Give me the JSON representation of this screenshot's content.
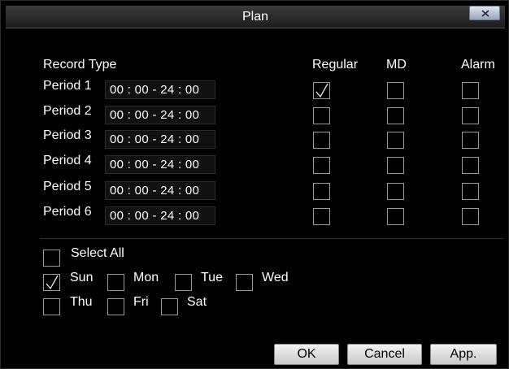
{
  "window": {
    "title": "Plan"
  },
  "header": {
    "record_type_label": "Record Type",
    "columns": [
      "Regular",
      "MD",
      "Alarm"
    ]
  },
  "periods": [
    {
      "label": "Period 1",
      "time": "00 : 00 - 24 : 00",
      "regular": true,
      "md": false,
      "alarm": false
    },
    {
      "label": "Period 2",
      "time": "00 : 00 - 24 : 00",
      "regular": false,
      "md": false,
      "alarm": false
    },
    {
      "label": "Period 3",
      "time": "00 : 00 - 24 : 00",
      "regular": false,
      "md": false,
      "alarm": false
    },
    {
      "label": "Period 4",
      "time": "00 : 00 - 24 : 00",
      "regular": false,
      "md": false,
      "alarm": false
    },
    {
      "label": "Period 5",
      "time": "00 : 00 - 24 : 00",
      "regular": false,
      "md": false,
      "alarm": false
    },
    {
      "label": "Period 6",
      "time": "00 : 00 - 24 : 00",
      "regular": false,
      "md": false,
      "alarm": false
    }
  ],
  "days": {
    "select_all": {
      "label": "Select All",
      "checked": false
    },
    "items": [
      {
        "label": "Sun",
        "checked": true
      },
      {
        "label": "Mon",
        "checked": false
      },
      {
        "label": "Tue",
        "checked": false
      },
      {
        "label": "Wed",
        "checked": false
      },
      {
        "label": "Thu",
        "checked": false
      },
      {
        "label": "Fri",
        "checked": false
      },
      {
        "label": "Sat",
        "checked": false
      }
    ]
  },
  "buttons": {
    "ok": "OK",
    "cancel": "Cancel",
    "apply": "App."
  }
}
